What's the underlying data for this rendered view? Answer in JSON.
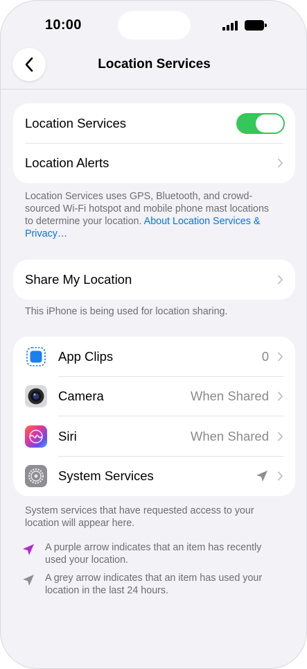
{
  "status": {
    "time": "10:00"
  },
  "nav": {
    "title": "Location Services"
  },
  "main_card": {
    "toggle_label": "Location Services",
    "toggle_on": true,
    "alerts_label": "Location Alerts"
  },
  "main_footer": {
    "text": "Location Services uses GPS, Bluetooth, and crowd-sourced Wi-Fi hotspot and mobile phone mast locations to determine your location. ",
    "link": "About Location Services & Privacy…"
  },
  "share": {
    "label": "Share My Location",
    "footer": "This iPhone is being used for location sharing."
  },
  "apps": [
    {
      "name": "App Clips",
      "value": "0",
      "icon": "app-clips-icon"
    },
    {
      "name": "Camera",
      "value": "When Shared",
      "icon": "camera-app-icon"
    },
    {
      "name": "Siri",
      "value": "When Shared",
      "icon": "siri-app-icon"
    },
    {
      "name": "System Services",
      "value": "",
      "icon": "settings-gear-icon"
    }
  ],
  "apps_footer": "System services that have requested access to your location will appear here.",
  "legend": {
    "purple": "A purple arrow indicates that an item has recently used your location.",
    "grey": "A grey arrow indicates that an item has used your location in the last 24 hours."
  },
  "colors": {
    "accent": "#0a72e5",
    "toggle_on": "#34c759",
    "purple_arrow": "#b428d6",
    "grey_arrow": "#8e8e93"
  }
}
